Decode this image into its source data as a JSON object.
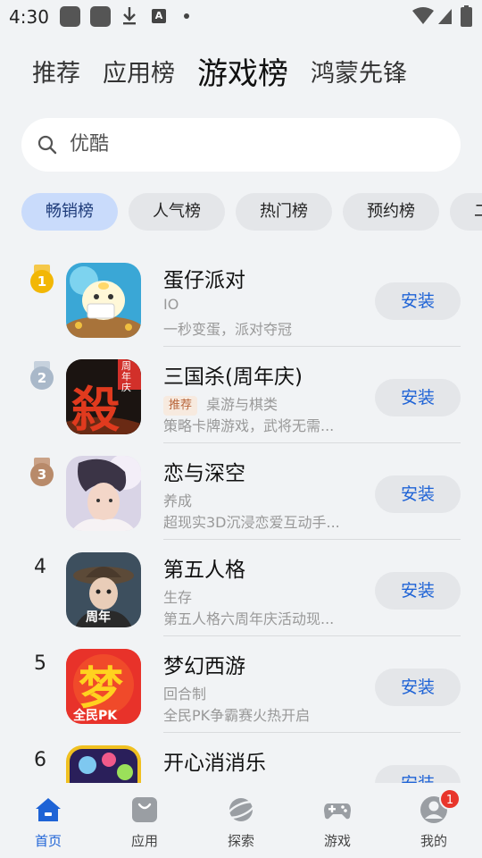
{
  "status_bar": {
    "time": "4:30",
    "icons": [
      "app-square-icon",
      "app-square-icon",
      "download-icon",
      "a-icon",
      "dot-icon",
      "wifi-icon",
      "signal-icon",
      "battery-icon"
    ]
  },
  "top_tabs": [
    {
      "label": "推荐",
      "active": false
    },
    {
      "label": "应用榜",
      "active": false
    },
    {
      "label": "游戏榜",
      "active": true
    },
    {
      "label": "鸿蒙先锋",
      "active": false
    }
  ],
  "search": {
    "value": "优酷",
    "icon": "search-icon"
  },
  "chips": [
    {
      "label": "畅销榜",
      "active": true
    },
    {
      "label": "人气榜",
      "active": false
    },
    {
      "label": "热门榜",
      "active": false
    },
    {
      "label": "预约榜",
      "active": false
    },
    {
      "label": "二",
      "active": false
    }
  ],
  "apps": [
    {
      "rank": "1",
      "medal": "gold",
      "name": "蛋仔派对",
      "tag": "",
      "category": "IO",
      "desc": "一秒变蛋，派对夺冠",
      "button": "安装"
    },
    {
      "rank": "2",
      "medal": "silver",
      "name": "三国杀(周年庆)",
      "tag": "推荐",
      "category": "桌游与棋类",
      "desc": "策略卡牌游戏，武将无需...",
      "button": "安装"
    },
    {
      "rank": "3",
      "medal": "bronze",
      "name": "恋与深空",
      "tag": "",
      "category": "养成",
      "desc": "超现实3D沉浸恋爱互动手...",
      "button": "安装"
    },
    {
      "rank": "4",
      "medal": "",
      "name": "第五人格",
      "tag": "",
      "category": "生存",
      "desc": "第五人格六周年庆活动现...",
      "button": "安装"
    },
    {
      "rank": "5",
      "medal": "",
      "name": "梦幻西游",
      "tag": "",
      "category": "回合制",
      "desc": "全民PK争霸赛火热开启",
      "button": "安装"
    },
    {
      "rank": "6",
      "medal": "",
      "name": "开心消消乐",
      "tag": "",
      "category": "消除",
      "desc": "",
      "button": "安装"
    }
  ],
  "icon_text": {
    "app2": "殺",
    "app2_corner": "周年庆",
    "app4": "周年",
    "app5": "梦",
    "app5_sub": "全民PK"
  },
  "bottom_nav": [
    {
      "label": "首页",
      "icon": "home-icon",
      "active": true
    },
    {
      "label": "应用",
      "icon": "shopping-bag-icon",
      "active": false
    },
    {
      "label": "探索",
      "icon": "planet-icon",
      "active": false
    },
    {
      "label": "游戏",
      "icon": "gamepad-icon",
      "active": false
    },
    {
      "label": "我的",
      "icon": "avatar-icon",
      "active": false,
      "badge": "1"
    }
  ],
  "colors": {
    "accent": "#1e63d6",
    "chip_active_bg": "#c9dbfb",
    "background": "#f1f3f5",
    "badge": "#e8352b",
    "gold": "#f2b705",
    "silver": "#a9b8c9",
    "bronze": "#b88a6a"
  }
}
